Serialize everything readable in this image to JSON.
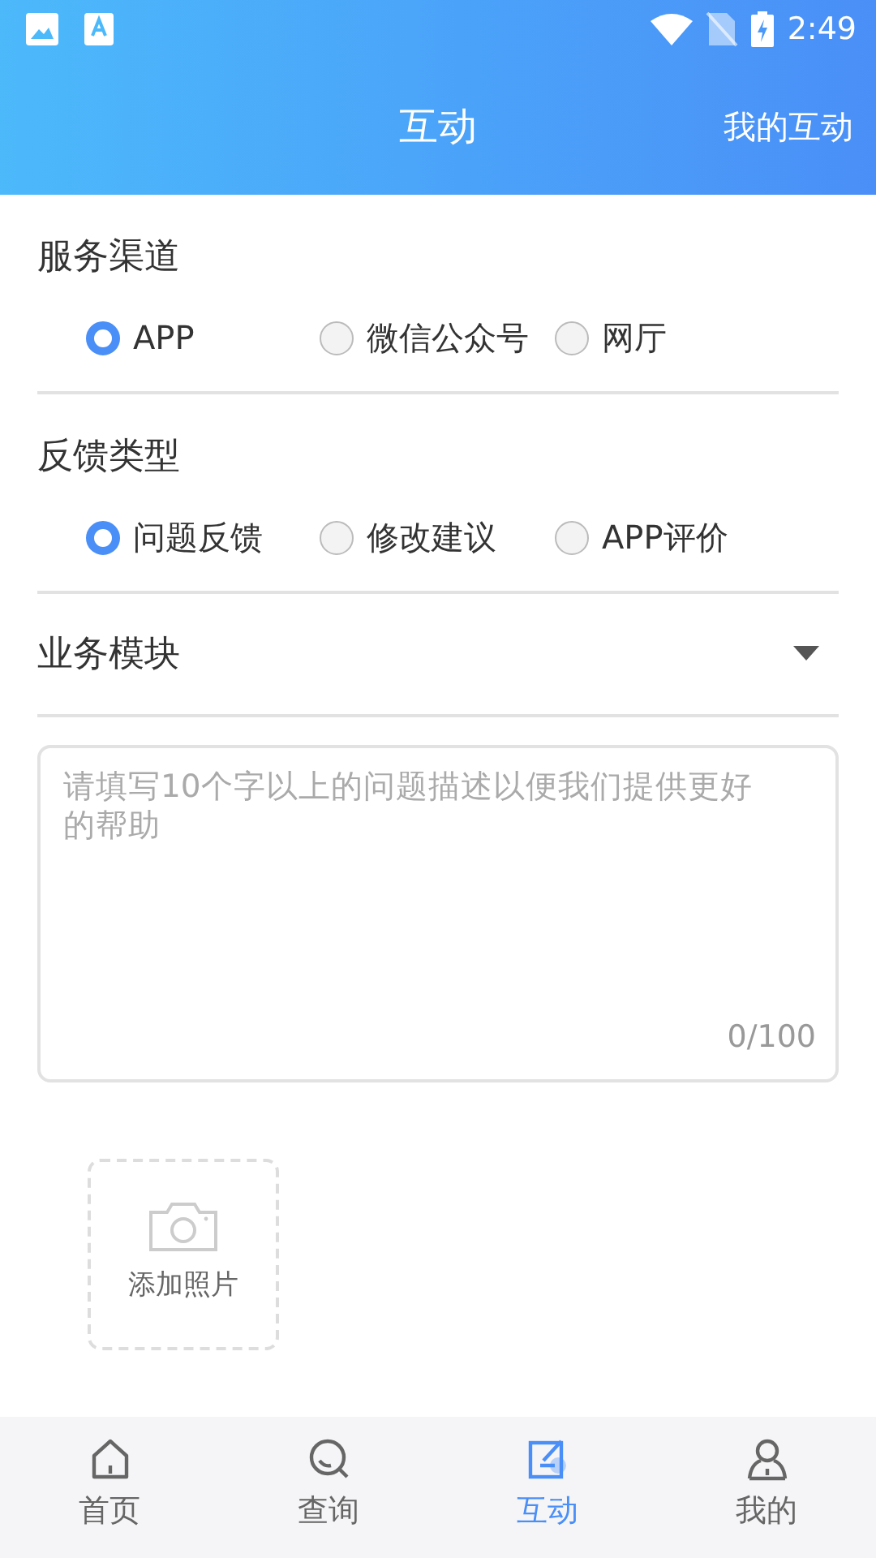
{
  "status_bar": {
    "time": "2:49"
  },
  "header": {
    "title": "互动",
    "action": "我的互动"
  },
  "groups": [
    {
      "label": "服务渠道",
      "options": [
        {
          "label": "APP",
          "selected": true
        },
        {
          "label": "微信公众号",
          "selected": false
        },
        {
          "label": "网厅",
          "selected": false
        }
      ]
    },
    {
      "label": "反馈类型",
      "options": [
        {
          "label": "问题反馈",
          "selected": true
        },
        {
          "label": "修改建议",
          "selected": false
        },
        {
          "label": "APP评价",
          "selected": false
        }
      ]
    }
  ],
  "module_select": {
    "label": "业务模块"
  },
  "description": {
    "placeholder": "请填写10个字以上的问题描述以便我们提供更好的帮助",
    "counter": "0/100"
  },
  "photo_upload": {
    "label": "添加照片"
  },
  "tabs": [
    {
      "label": "首页",
      "kind": "home",
      "selected": false
    },
    {
      "label": "查询",
      "kind": "search",
      "selected": false
    },
    {
      "label": "互动",
      "kind": "edit",
      "selected": true
    },
    {
      "label": "我的",
      "kind": "user",
      "selected": false
    }
  ]
}
